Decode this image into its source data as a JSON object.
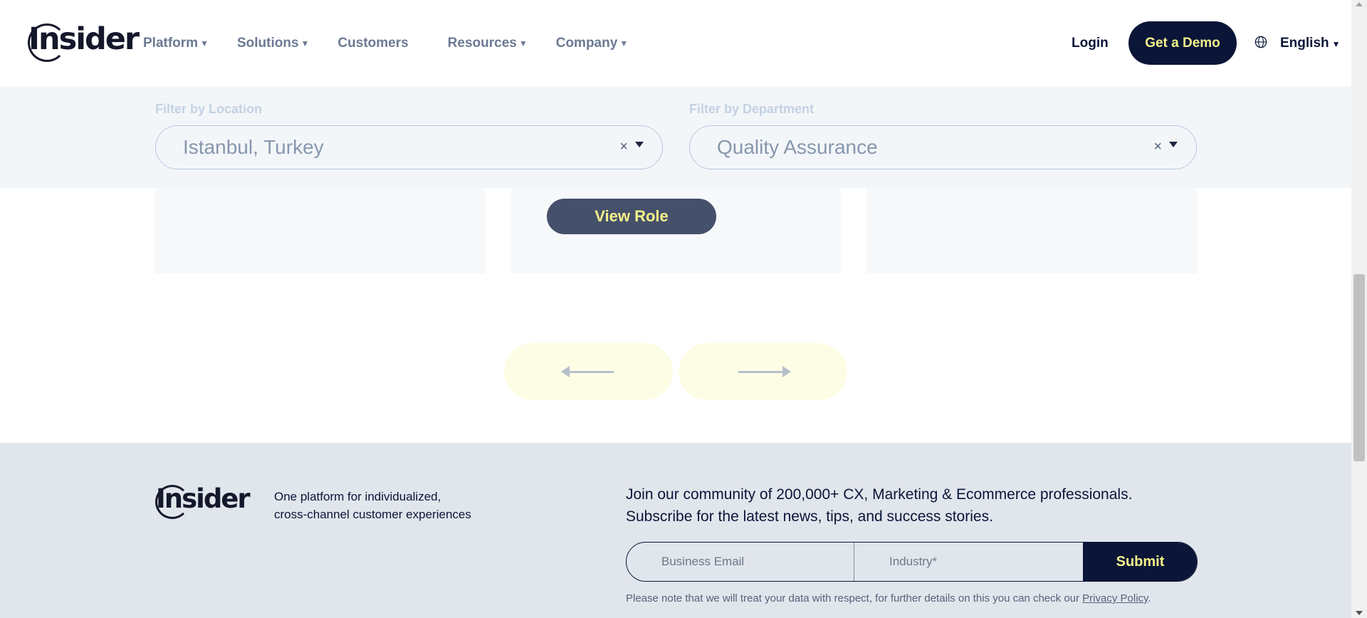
{
  "header": {
    "logo_text": "Insider",
    "nav": [
      {
        "label": "Platform",
        "has_dropdown": true
      },
      {
        "label": "Solutions",
        "has_dropdown": true
      },
      {
        "label": "Customers",
        "has_dropdown": false
      },
      {
        "label": "Resources",
        "has_dropdown": true
      },
      {
        "label": "Company",
        "has_dropdown": true
      }
    ],
    "login_label": "Login",
    "demo_label": "Get a Demo",
    "language_label": "English",
    "language_icon": "globe-icon"
  },
  "filters": {
    "location_label": "Filter by Location",
    "location_value": "Istanbul, Turkey",
    "department_label": "Filter by Department",
    "department_value": "Quality Assurance",
    "clear_symbol": "×"
  },
  "jobs": {
    "view_role_label": "View Role"
  },
  "pager": {
    "prev_icon": "arrow-left-icon",
    "next_icon": "arrow-right-icon"
  },
  "footer": {
    "logo_text": "Insider",
    "tagline_line1": "One platform for individualized,",
    "tagline_line2": "cross-channel customer experiences",
    "join_line1": "Join our community of 200,000+ CX, Marketing & Ecommerce professionals.",
    "join_line2": "Subscribe for the latest news, tips, and success stories.",
    "email_placeholder": "Business Email",
    "industry_placeholder": "Industry*",
    "submit_label": "Submit",
    "note_text": "Please note that we will treat your data with respect, for further details on this you can check our ",
    "privacy_link": "Privacy Policy",
    "note_end": "."
  },
  "colors": {
    "navy": "#0a1538",
    "yellow": "#f5f28a",
    "footer_bg": "#e1e6ec"
  }
}
